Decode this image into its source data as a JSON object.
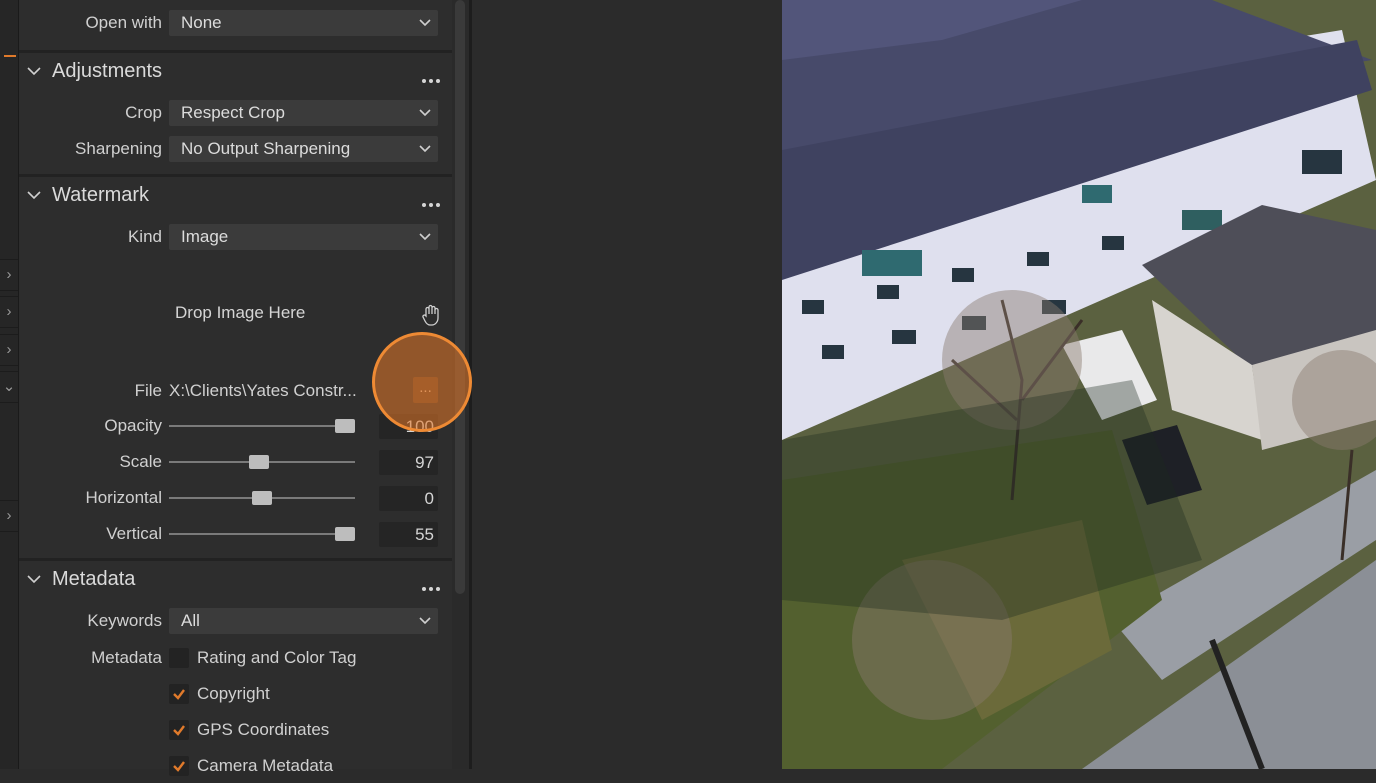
{
  "export": {
    "open_with": {
      "label": "Open with",
      "value": "None"
    },
    "adjustments": {
      "title": "Adjustments",
      "crop": {
        "label": "Crop",
        "value": "Respect Crop"
      },
      "sharpening": {
        "label": "Sharpening",
        "value": "No Output Sharpening"
      }
    },
    "watermark": {
      "title": "Watermark",
      "kind": {
        "label": "Kind",
        "value": "Image"
      },
      "drop_text": "Drop Image Here",
      "file": {
        "label": "File",
        "value": "X:\\Clients\\Yates Constr...",
        "browse_label": "..."
      },
      "opacity": {
        "label": "Opacity",
        "value": "100",
        "fraction": 1.0
      },
      "scale": {
        "label": "Scale",
        "value": "97",
        "fraction": 0.48
      },
      "horizontal": {
        "label": "Horizontal",
        "value": "0",
        "fraction": 0.5
      },
      "vertical": {
        "label": "Vertical",
        "value": "55",
        "fraction": 1.0
      }
    },
    "metadata": {
      "title": "Metadata",
      "keywords": {
        "label": "Keywords",
        "value": "All"
      },
      "metadata_label": "Metadata",
      "options": [
        {
          "label": "Rating and Color Tag",
          "checked": false
        },
        {
          "label": "Copyright",
          "checked": true
        },
        {
          "label": "GPS Coordinates",
          "checked": true
        },
        {
          "label": "Camera Metadata",
          "checked": true
        }
      ]
    }
  },
  "colors": {
    "accent": "#e07a2b",
    "panel": "#2d2d2d",
    "field": "#3b3b3b"
  }
}
